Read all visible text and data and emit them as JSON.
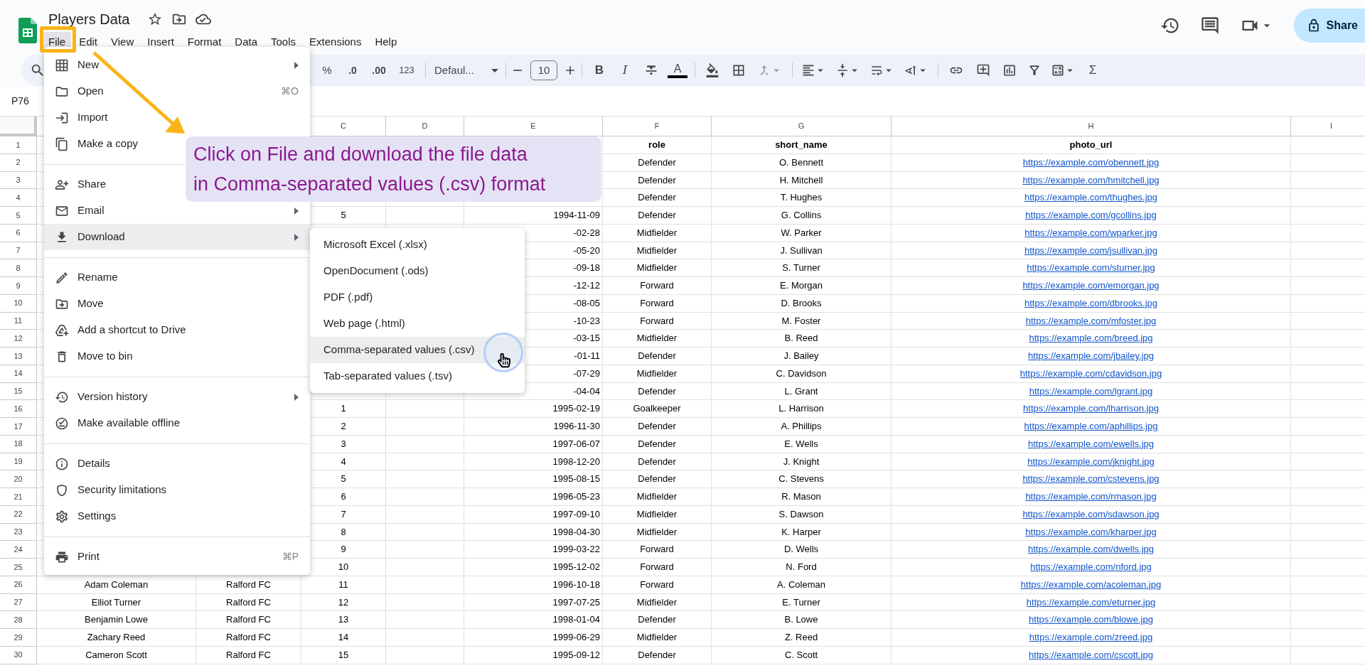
{
  "document": {
    "title": "Players Data"
  },
  "menu_bar": [
    {
      "label": "File",
      "selected": true
    },
    {
      "label": "Edit",
      "selected": false
    },
    {
      "label": "View",
      "selected": false
    },
    {
      "label": "Insert",
      "selected": false
    },
    {
      "label": "Format",
      "selected": false
    },
    {
      "label": "Data",
      "selected": false
    },
    {
      "label": "Tools",
      "selected": false
    },
    {
      "label": "Extensions",
      "selected": false
    },
    {
      "label": "Help",
      "selected": false
    }
  ],
  "share_button": "Share",
  "toolbar": {
    "percent": "%",
    "decrease_decimals": ".0",
    "increase_decimals": ".00",
    "number_format": "123",
    "font": "Defaul...",
    "font_size": "10",
    "bold": "B",
    "italic": "I",
    "text_color": "A",
    "functions": "Σ"
  },
  "name_box": "P76",
  "column_headers": {
    "C": "C",
    "D": "D",
    "E": "E",
    "F": "F",
    "G": "G",
    "H": "H",
    "I": "I"
  },
  "rows": [
    {
      "number": "1",
      "kind": "header",
      "cells": {
        "F": "role",
        "G": "short_name",
        "H": "photo_url"
      }
    },
    {
      "number": "2",
      "kind": "data",
      "cells": {
        "F": "Defender",
        "G": "O. Bennett",
        "H": "https://example.com/obennett.jpg"
      }
    },
    {
      "number": "3",
      "kind": "data",
      "cells": {
        "F": "Defender",
        "G": "H. Mitchell",
        "H": "https://example.com/hmitchell.jpg"
      }
    },
    {
      "number": "4",
      "kind": "data",
      "cells": {
        "F": "Defender",
        "G": "T. Hughes",
        "H": "https://example.com/thughes.jpg"
      }
    },
    {
      "number": "5",
      "kind": "data",
      "cells": {
        "C": "5",
        "E": "1994-11-09",
        "F": "Defender",
        "G": "G. Collins",
        "H": "https://example.com/gcollins.jpg"
      }
    },
    {
      "number": "6",
      "kind": "data",
      "cells": {
        "E": "-02-28",
        "F": "Midfielder",
        "G": "W. Parker",
        "H": "https://example.com/wparker.jpg"
      }
    },
    {
      "number": "7",
      "kind": "data",
      "cells": {
        "E": "-05-20",
        "F": "Midfielder",
        "G": "J. Sullivan",
        "H": "https://example.com/jsullivan.jpg"
      }
    },
    {
      "number": "8",
      "kind": "data",
      "cells": {
        "E": "-09-18",
        "F": "Midfielder",
        "G": "S. Turner",
        "H": "https://example.com/sturner.jpg"
      }
    },
    {
      "number": "9",
      "kind": "data",
      "cells": {
        "E": "-12-12",
        "F": "Forward",
        "G": "E. Morgan",
        "H": "https://example.com/emorgan.jpg"
      }
    },
    {
      "number": "10",
      "kind": "data",
      "cells": {
        "E": "-08-05",
        "F": "Forward",
        "G": "D. Brooks",
        "H": "https://example.com/dbrooks.jpg"
      }
    },
    {
      "number": "11",
      "kind": "data",
      "cells": {
        "E": "-10-23",
        "F": "Forward",
        "G": "M. Foster",
        "H": "https://example.com/mfoster.jpg"
      }
    },
    {
      "number": "12",
      "kind": "data",
      "cells": {
        "E": "-03-15",
        "F": "Midfielder",
        "G": "B. Reed",
        "H": "https://example.com/breed.jpg"
      }
    },
    {
      "number": "13",
      "kind": "data",
      "cells": {
        "E": "-01-11",
        "F": "Defender",
        "G": "J. Bailey",
        "H": "https://example.com/jbailey.jpg"
      }
    },
    {
      "number": "14",
      "kind": "data",
      "cells": {
        "E": "-07-29",
        "F": "Midfielder",
        "G": "C. Davidson",
        "H": "https://example.com/cdavidson.jpg"
      }
    },
    {
      "number": "15",
      "kind": "data",
      "cells": {
        "E": "-04-04",
        "F": "Defender",
        "G": "L. Grant",
        "H": "https://example.com/lgrant.jpg"
      }
    },
    {
      "number": "16",
      "kind": "data",
      "cells": {
        "C": "1",
        "E": "1995-02-19",
        "F": "Goalkeeper",
        "G": "L. Harrison",
        "H": "https://example.com/lharrison.jpg"
      }
    },
    {
      "number": "17",
      "kind": "data",
      "cells": {
        "C": "2",
        "E": "1996-11-30",
        "F": "Defender",
        "G": "A. Phillips",
        "H": "https://example.com/aphillips.jpg"
      }
    },
    {
      "number": "18",
      "kind": "data",
      "cells": {
        "C": "3",
        "E": "1997-06-07",
        "F": "Defender",
        "G": "E. Wells",
        "H": "https://example.com/ewells.jpg"
      }
    },
    {
      "number": "19",
      "kind": "data",
      "cells": {
        "C": "4",
        "E": "1998-12-20",
        "F": "Defender",
        "G": "J. Knight",
        "H": "https://example.com/jknight.jpg"
      }
    },
    {
      "number": "20",
      "kind": "data",
      "cells": {
        "C": "5",
        "E": "1995-08-15",
        "F": "Defender",
        "G": "C. Stevens",
        "H": "https://example.com/cstevens.jpg"
      }
    },
    {
      "number": "21",
      "kind": "data",
      "cells": {
        "C": "6",
        "E": "1996-05-23",
        "F": "Midfielder",
        "G": "R. Mason",
        "H": "https://example.com/rmason.jpg"
      }
    },
    {
      "number": "22",
      "kind": "data",
      "cells": {
        "C": "7",
        "E": "1997-09-10",
        "F": "Midfielder",
        "G": "S. Dawson",
        "H": "https://example.com/sdawson.jpg"
      }
    },
    {
      "number": "23",
      "kind": "data",
      "cells": {
        "C": "8",
        "E": "1998-04-30",
        "F": "Midfielder",
        "G": "K. Harper",
        "H": "https://example.com/kharper.jpg"
      }
    },
    {
      "number": "24",
      "kind": "data",
      "cells": {
        "C": "9",
        "E": "1999-03-22",
        "F": "Forward",
        "G": "D. Wells",
        "H": "https://example.com/dwells.jpg"
      }
    },
    {
      "number": "25",
      "kind": "data",
      "cells": {
        "C": "10",
        "E": "1995-12-02",
        "F": "Forward",
        "G": "N. Ford",
        "H": "https://example.com/nford.jpg"
      }
    },
    {
      "number": "26",
      "kind": "data",
      "cells": {
        "A": "Adam Coleman",
        "B": "Ralford FC",
        "C": "11",
        "E": "1996-10-18",
        "F": "Forward",
        "G": "A. Coleman",
        "H": "https://example.com/acoleman.jpg"
      }
    },
    {
      "number": "27",
      "kind": "data",
      "cells": {
        "A": "Elliot Turner",
        "B": "Ralford FC",
        "C": "12",
        "E": "1997-07-25",
        "F": "Midfielder",
        "G": "E. Turner",
        "H": "https://example.com/eturner.jpg"
      }
    },
    {
      "number": "28",
      "kind": "data",
      "cells": {
        "A": "Benjamin Lowe",
        "B": "Ralford FC",
        "C": "13",
        "E": "1998-01-04",
        "F": "Defender",
        "G": "B. Lowe",
        "H": "https://example.com/blowe.jpg"
      }
    },
    {
      "number": "29",
      "kind": "data",
      "cells": {
        "A": "Zachary Reed",
        "B": "Ralford FC",
        "C": "14",
        "E": "1999-06-29",
        "F": "Midfielder",
        "G": "Z. Reed",
        "H": "https://example.com/zreed.jpg"
      }
    },
    {
      "number": "30",
      "kind": "data",
      "cells": {
        "A": "Cameron Scott",
        "B": "Ralford FC",
        "C": "15",
        "E": "1995-09-12",
        "F": "Defender",
        "G": "C. Scott",
        "H": "https://example.com/cscott.jpg"
      }
    }
  ],
  "file_menu": [
    {
      "kind": "item",
      "label": "New",
      "submenu": true,
      "selected": false
    },
    {
      "kind": "item",
      "label": "Open",
      "shortcut": "⌘O",
      "submenu": false,
      "selected": false
    },
    {
      "kind": "item",
      "label": "Import",
      "submenu": false,
      "selected": false
    },
    {
      "kind": "item",
      "label": "Make a copy",
      "submenu": false,
      "selected": false
    },
    {
      "kind": "separator"
    },
    {
      "kind": "item",
      "label": "Share",
      "submenu": false,
      "selected": false
    },
    {
      "kind": "item",
      "label": "Email",
      "submenu": true,
      "selected": false
    },
    {
      "kind": "item",
      "label": "Download",
      "submenu": true,
      "selected": true
    },
    {
      "kind": "separator"
    },
    {
      "kind": "item",
      "label": "Rename",
      "submenu": false,
      "selected": false
    },
    {
      "kind": "item",
      "label": "Move",
      "submenu": false,
      "selected": false
    },
    {
      "kind": "item",
      "label": "Add a shortcut to Drive",
      "submenu": false,
      "selected": false
    },
    {
      "kind": "item",
      "label": "Move to bin",
      "submenu": false,
      "selected": false
    },
    {
      "kind": "separator"
    },
    {
      "kind": "item",
      "label": "Version history",
      "submenu": true,
      "selected": false
    },
    {
      "kind": "item",
      "label": "Make available offline",
      "submenu": false,
      "selected": false
    },
    {
      "kind": "separator"
    },
    {
      "kind": "item",
      "label": "Details",
      "submenu": false,
      "selected": false
    },
    {
      "kind": "item",
      "label": "Security limitations",
      "submenu": false,
      "selected": false
    },
    {
      "kind": "item",
      "label": "Settings",
      "submenu": false,
      "selected": false
    },
    {
      "kind": "separator"
    },
    {
      "kind": "item",
      "label": "Print",
      "shortcut": "⌘P",
      "submenu": false,
      "selected": false
    }
  ],
  "download_menu": [
    {
      "label": "Microsoft Excel (.xlsx)",
      "selected": false
    },
    {
      "label": "OpenDocument (.ods)",
      "selected": false
    },
    {
      "label": "PDF (.pdf)",
      "selected": false
    },
    {
      "label": "Web page (.html)",
      "selected": false
    },
    {
      "label": "Comma-separated values (.csv)",
      "selected": true
    },
    {
      "label": "Tab-separated values (.tsv)",
      "selected": false
    }
  ],
  "callout": {
    "lines": [
      "Click on File and download the file data",
      "in Comma-separated values (.csv) format"
    ]
  }
}
